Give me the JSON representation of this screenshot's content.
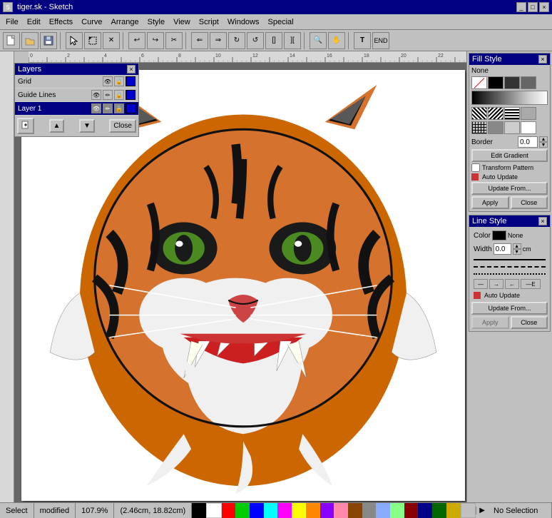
{
  "title": "tiger.sk - Sketch",
  "menu": {
    "items": [
      "File",
      "Edit",
      "Effects",
      "Curve",
      "Arrange",
      "Style",
      "View",
      "Script",
      "Windows",
      "Special"
    ]
  },
  "layers_panel": {
    "title": "Layers",
    "rows": [
      {
        "name": "Grid",
        "active": false
      },
      {
        "name": "Guide Lines",
        "active": false
      },
      {
        "name": "Layer 1",
        "active": true
      }
    ],
    "close_label": "×",
    "btn_up": "▲",
    "btn_down": "▼",
    "btn_close": "Close"
  },
  "fill_style": {
    "title": "Fill Style",
    "close_label": "×",
    "none_label": "None",
    "border_label": "Border",
    "border_value": "0.0",
    "border_unit": "",
    "edit_gradient_label": "Edit Gradient",
    "transform_pattern_label": "Transform Pattern",
    "auto_update_label": "Auto Update",
    "update_from_label": "Update From...",
    "apply_label": "Apply",
    "close_btn_label": "Close"
  },
  "line_style": {
    "title": "Line Style",
    "close_label": "×",
    "color_label": "Color",
    "color_value": "None",
    "width_label": "Width",
    "width_value": "0.0",
    "width_unit": "cm",
    "auto_update_label": "Auto Update",
    "update_from_label": "Update From...",
    "apply_label": "Apply",
    "close_btn_label": "Close"
  },
  "statusbar": {
    "tool": "Select",
    "modified": "modified",
    "zoom": "107.9%",
    "coords": "(2.46cm, 18.82cm)",
    "selection": "No Selection"
  }
}
